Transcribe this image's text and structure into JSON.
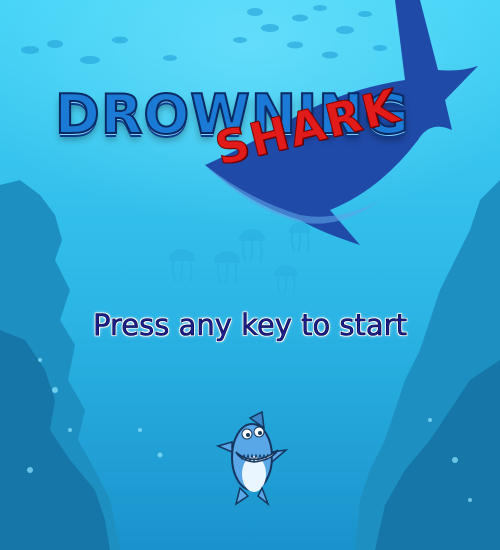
{
  "game": {
    "title": "DROWNING",
    "subtitle": "SHARK",
    "prompt": "Press any key to start"
  },
  "colors": {
    "sky": "#3fd0f5",
    "deep": "#1380b8",
    "shark_logo": "#1f4aa8",
    "title_blue": "#1a7ad6",
    "subtitle_red": "#e11a1a",
    "prompt_text": "#1c1f8a"
  },
  "icons": {
    "logo_shark": "shark-silhouette-icon",
    "player": "shark-character-icon"
  }
}
